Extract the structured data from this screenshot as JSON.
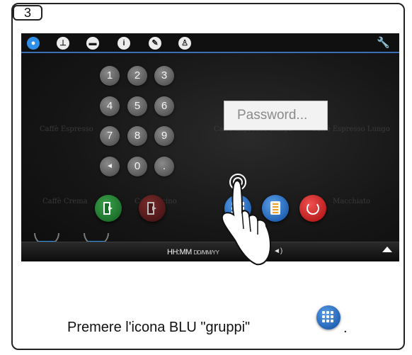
{
  "step": {
    "number": "3"
  },
  "screen": {
    "background_labels": [
      "Caffè Espresso",
      "Caffè Espresso Lungo",
      "Caffè Espresso Lungo",
      "Caffè Crema",
      "Cappuccino",
      "Macchiato"
    ],
    "top_icons": [
      "water-drop-icon",
      "clock-icon",
      "flag-icon",
      "info-icon",
      "pencil-icon",
      "user-lock-icon"
    ],
    "keypad": [
      "1",
      "2",
      "3",
      "4",
      "5",
      "6",
      "7",
      "8",
      "9",
      "◄",
      "0",
      "."
    ],
    "password": {
      "placeholder": "Password..."
    },
    "clock": {
      "time": "HH:MM",
      "date": "DD/MM/YY"
    },
    "colors": {
      "accent": "#3b6fb5",
      "blue_button": "#1f5fb0",
      "red_button": "#b81c1c",
      "green_button": "#1c6f2a"
    }
  },
  "caption": {
    "text": "Premere l'icona BLU \"gruppi\"",
    "end": "."
  }
}
